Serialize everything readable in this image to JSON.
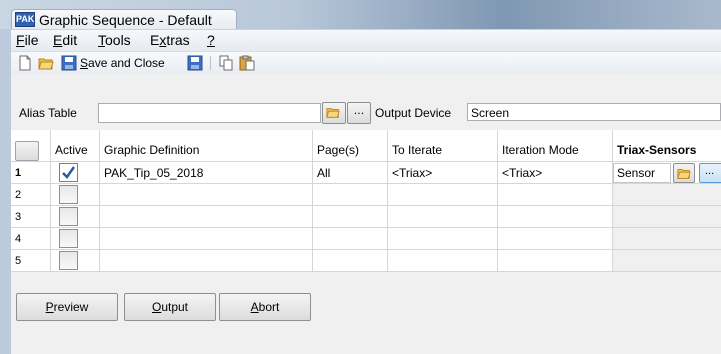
{
  "window": {
    "title": "Graphic Sequence - Default",
    "logo": "PAK"
  },
  "menu": {
    "items": [
      {
        "label": "File",
        "accel": "F",
        "rest": "ile"
      },
      {
        "label": "Edit",
        "accel": "E",
        "rest": "dit"
      },
      {
        "label": "Tools",
        "accel": "T",
        "rest": "ools"
      },
      {
        "label": "Extras",
        "accel_pre": "E",
        "accel": "x",
        "rest": "tras"
      },
      {
        "label": "?",
        "accel": "?",
        "rest": ""
      }
    ]
  },
  "toolbar": {
    "save_close_accel": "S",
    "save_close_rest": "ave and Close",
    "icons": [
      "new-icon",
      "open-folder-icon",
      "save-icon",
      "save-icon",
      "copy-icon",
      "paste-icon"
    ]
  },
  "alias": {
    "label": "Alias Table",
    "value": "",
    "dots": "...",
    "output_label": "Output Device",
    "output_value": "Screen"
  },
  "grid": {
    "columns": [
      "Active",
      "Graphic Definition",
      "Page(s)",
      "To Iterate",
      "Iteration Mode",
      "Triax-Sensors"
    ],
    "rows": [
      {
        "num": "1",
        "active": true,
        "definition": "PAK_Tip_05_2018",
        "pages": "All",
        "iterate": "<Triax>",
        "mode": "<Triax>",
        "sensor": "Sensor"
      },
      {
        "num": "2",
        "active": false,
        "definition": "",
        "pages": "",
        "iterate": "",
        "mode": "",
        "sensor": ""
      },
      {
        "num": "3",
        "active": false,
        "definition": "",
        "pages": "",
        "iterate": "",
        "mode": "",
        "sensor": ""
      },
      {
        "num": "4",
        "active": false,
        "definition": "",
        "pages": "",
        "iterate": "",
        "mode": "",
        "sensor": ""
      },
      {
        "num": "5",
        "active": false,
        "definition": "",
        "pages": "",
        "iterate": "",
        "mode": "",
        "sensor": ""
      }
    ],
    "sensor_dots": "..."
  },
  "buttons": {
    "preview_accel": "P",
    "preview_rest": "review",
    "output_accel": "O",
    "output_rest": "utput",
    "abort_accel": "A",
    "abort_rest": "bort"
  },
  "colors": {
    "accent": "#3061b3",
    "check": "#2a5aa6"
  }
}
